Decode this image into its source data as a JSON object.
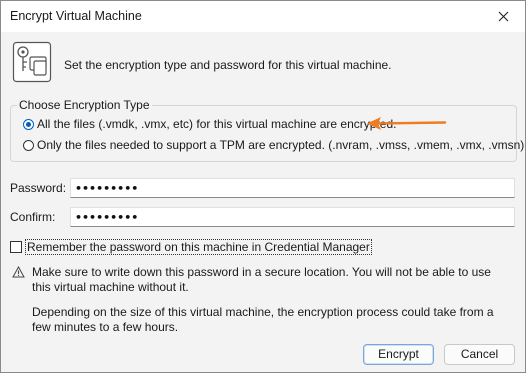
{
  "window": {
    "title": "Encrypt Virtual Machine"
  },
  "header": {
    "description": "Set the encryption type and password for this virtual machine."
  },
  "encryption_type": {
    "legend": "Choose Encryption Type",
    "options": [
      {
        "label": "All the files (.vmdk, .vmx, etc) for this virtual machine are encrypted.",
        "selected": true
      },
      {
        "label": "Only the files needed to support a TPM are encrypted. (.nvram, .vmss, .vmem, .vmx, .vmsn)",
        "selected": false
      }
    ],
    "annotation_color": "#f07c22"
  },
  "password": {
    "label": "Password:",
    "value": "•••••••••"
  },
  "confirm": {
    "label": "Confirm:",
    "value": "•••••••••"
  },
  "remember": {
    "label": "Remember the password on this machine in Credential Manager",
    "checked": false
  },
  "notes": [
    "Make sure to write down this password in a secure location. You will not be able to use this virtual machine without it.",
    "Depending on the size of this virtual machine, the encryption process could take from a few minutes to a few hours."
  ],
  "buttons": {
    "encrypt": "Encrypt",
    "cancel": "Cancel"
  },
  "icons": {
    "header": "vm-key-icon",
    "warning": "warning-icon",
    "close": "close-icon"
  }
}
